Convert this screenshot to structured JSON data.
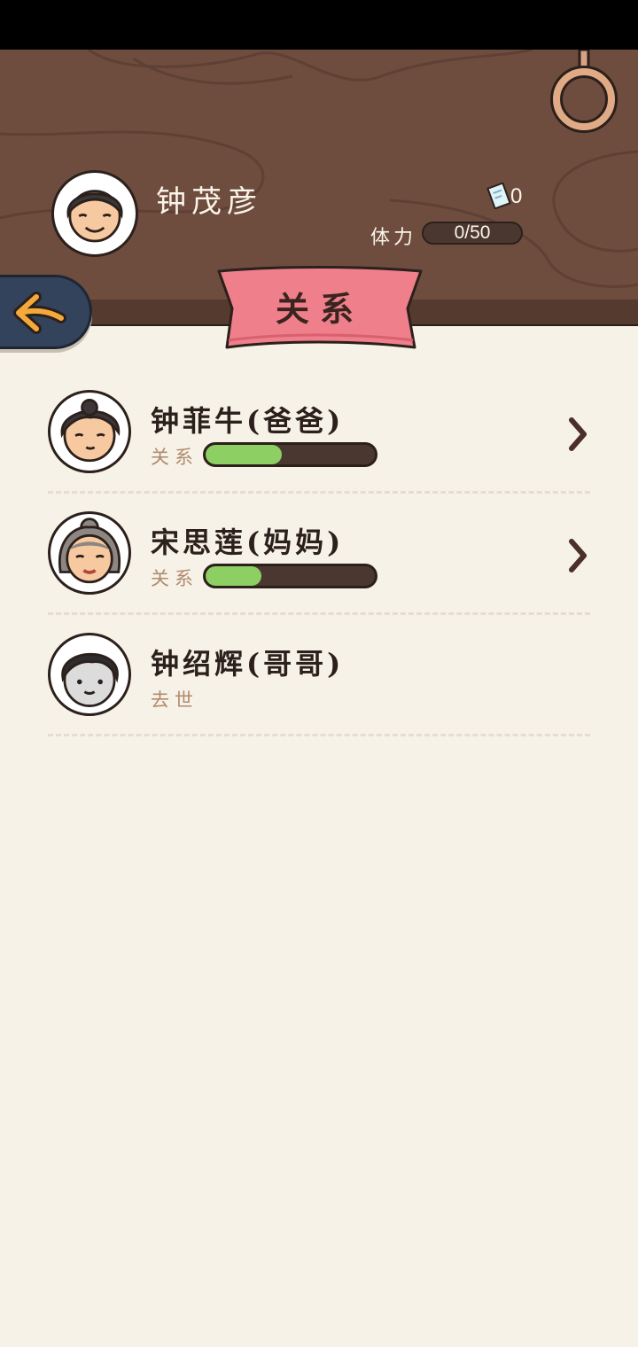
{
  "player": {
    "name": "钟茂彦",
    "ticket_count": "0",
    "stamina_label": "体力",
    "stamina_value": "0/50"
  },
  "page_title": "关系",
  "relatives": [
    {
      "name": "钟菲牛(爸爸)",
      "relation_label": "关系",
      "relation_level": 0.45,
      "avatar": "father-avatar"
    },
    {
      "name": "宋思莲(妈妈)",
      "relation_label": "关系",
      "relation_level": 0.33,
      "avatar": "mother-avatar"
    },
    {
      "name": "钟绍辉(哥哥)",
      "status": "去世",
      "avatar": "brother-avatar"
    }
  ],
  "colors": {
    "header_wood": "#6e4d3e",
    "banner_pink": "#ef7f8a",
    "relation_fill": "#8ecf63",
    "back_button": "#33435c",
    "back_arrow": "#f5a93a"
  },
  "icons": [
    "ring-icon",
    "ticket-icon",
    "back-arrow-icon",
    "chevron-right-icon"
  ]
}
